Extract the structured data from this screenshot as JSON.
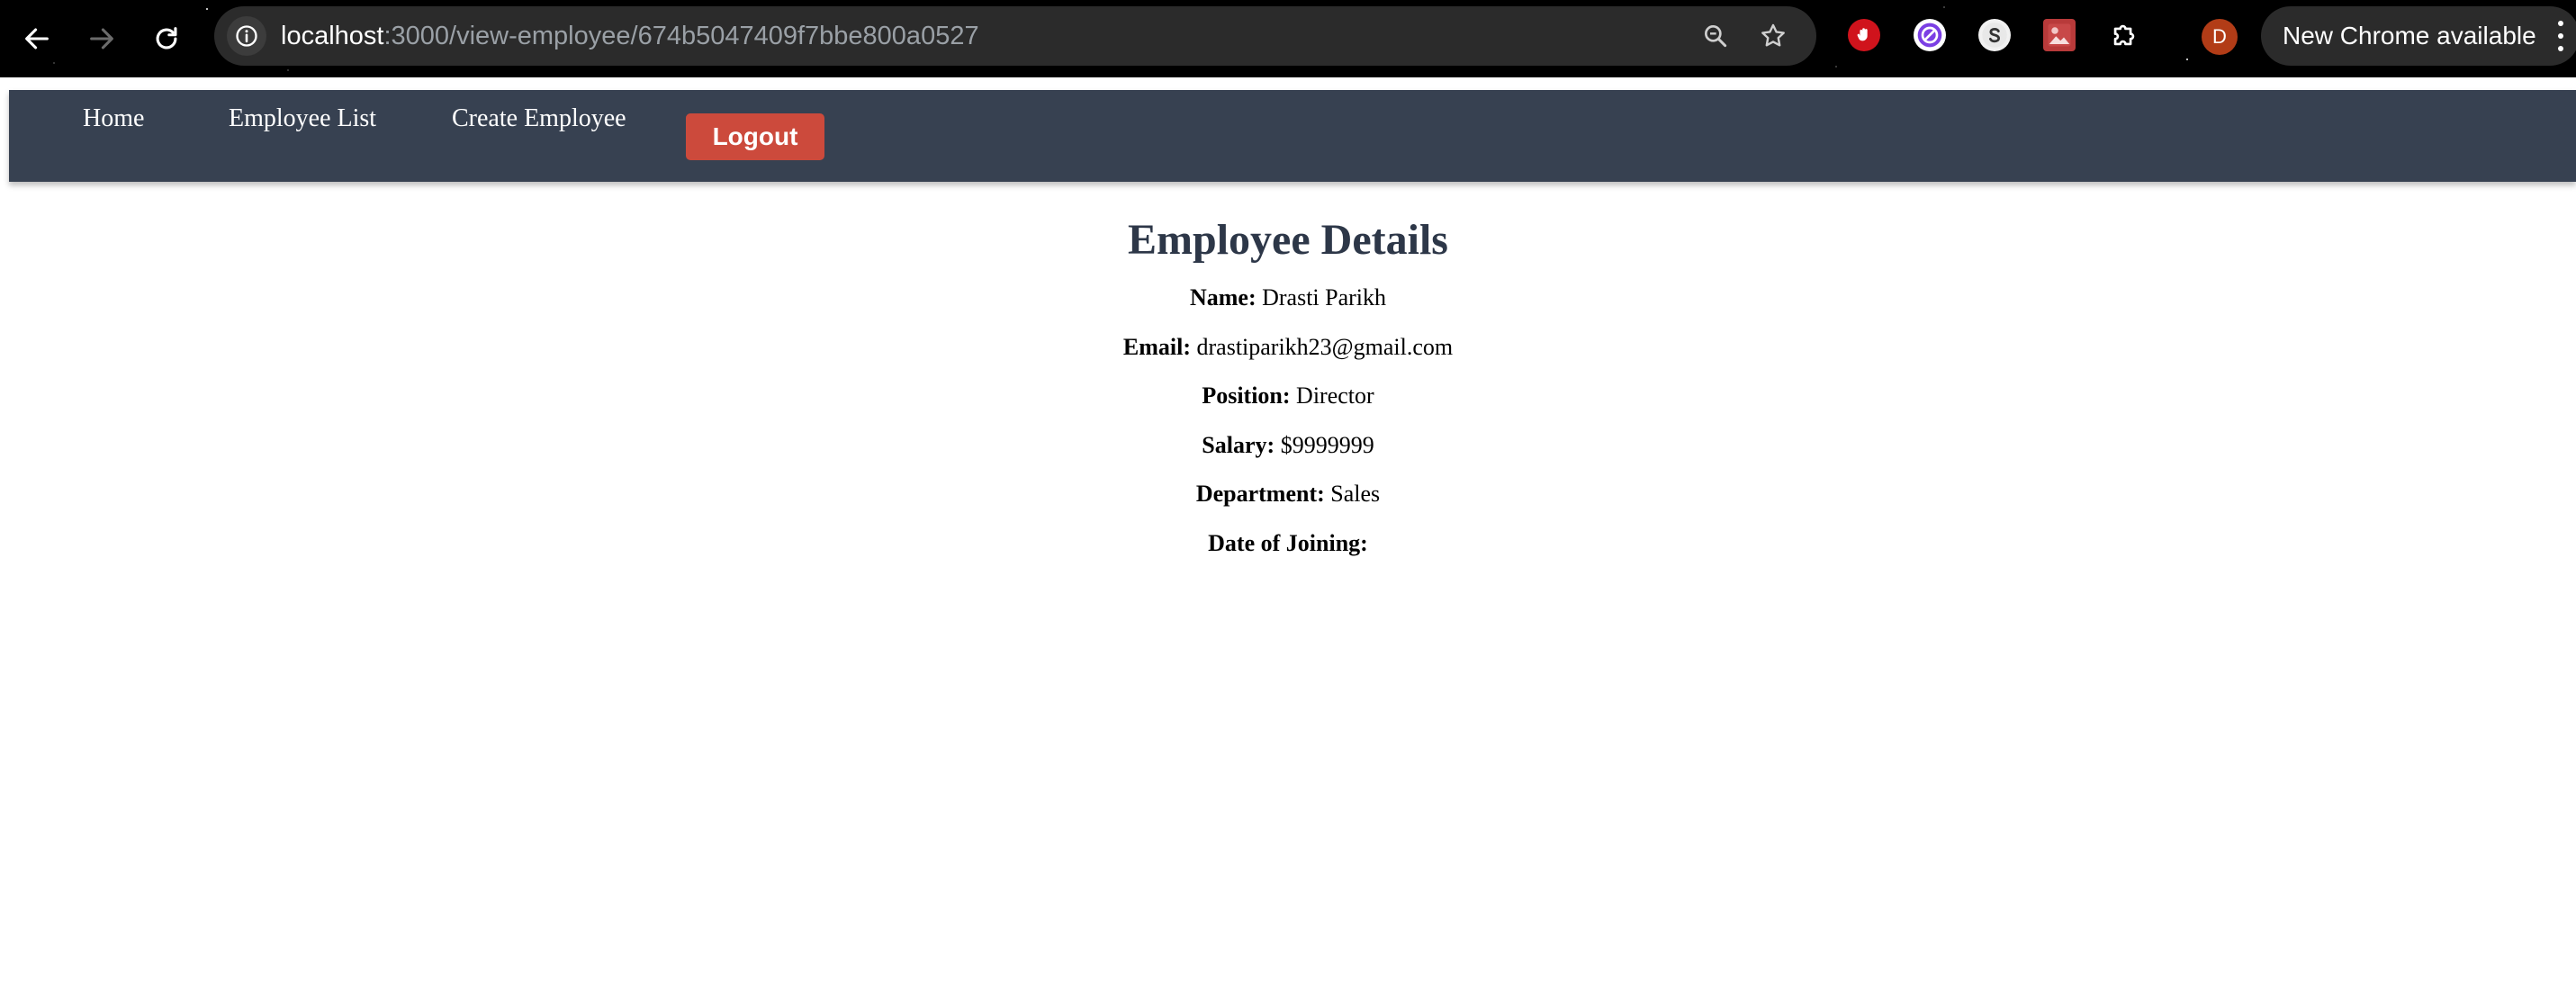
{
  "browser": {
    "url_host": "localhost",
    "url_path": ":3000/view-employee/674b5047409f7bbe800a0527",
    "profile_initial": "D",
    "update_text": "New Chrome available"
  },
  "nav": {
    "home": "Home",
    "employee_list": "Employee List",
    "create_employee": "Create Employee",
    "logout": "Logout"
  },
  "details": {
    "title": "Employee Details",
    "fields": [
      {
        "label": "Name:",
        "value": "Drasti Parikh"
      },
      {
        "label": "Email:",
        "value": "drastiparikh23@gmail.com"
      },
      {
        "label": "Position:",
        "value": "Director"
      },
      {
        "label": "Salary:",
        "value": "$9999999"
      },
      {
        "label": "Department:",
        "value": "Sales"
      },
      {
        "label": "Date of Joining:",
        "value": ""
      }
    ]
  },
  "colors": {
    "nav_bg": "#374151",
    "logout_bg": "#cc4a3c",
    "title_color": "#2d3748"
  },
  "icons": [
    "back-arrow-icon",
    "forward-arrow-icon",
    "reload-icon",
    "site-info-icon",
    "zoom-icon",
    "bookmark-star-icon",
    "adblock-hand-icon",
    "block-site-icon",
    "s-extension-icon",
    "image-extension-icon",
    "puzzle-extensions-icon",
    "menu-kebab-icon"
  ]
}
